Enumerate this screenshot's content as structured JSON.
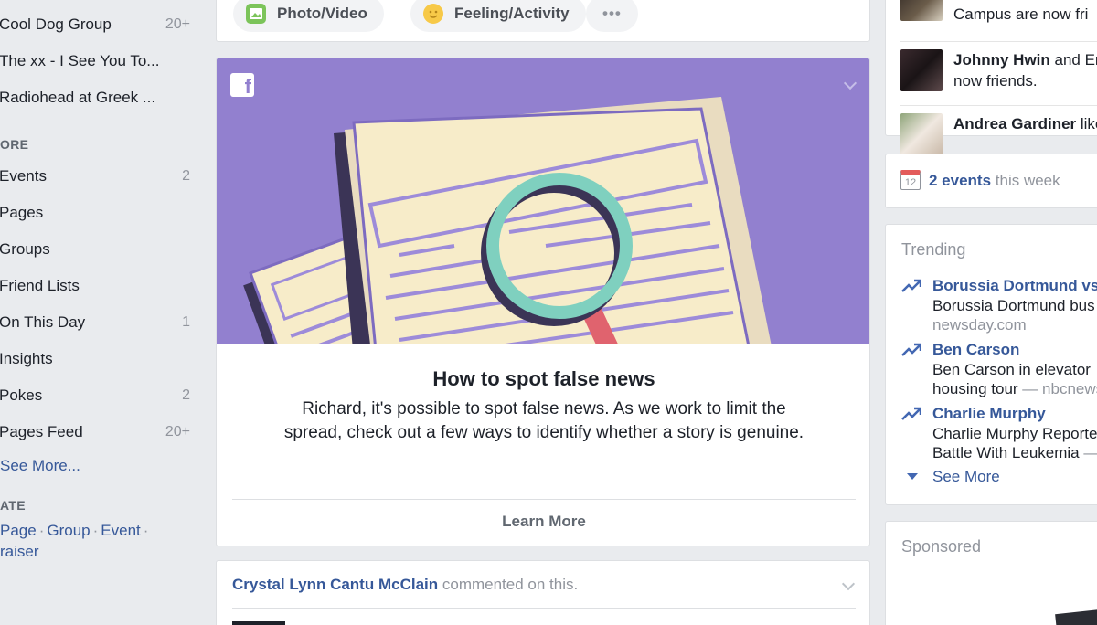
{
  "left_nav": {
    "shortcuts": [
      {
        "label": "Cool Dog Group",
        "count": "20+"
      },
      {
        "label": "The xx - I See You To...",
        "count": ""
      },
      {
        "label": "Radiohead at Greek ...",
        "count": ""
      }
    ],
    "explore_heading": "ORE",
    "explore": [
      {
        "label": "Events",
        "count": "2"
      },
      {
        "label": "Pages",
        "count": ""
      },
      {
        "label": "Groups",
        "count": ""
      },
      {
        "label": "Friend Lists",
        "count": ""
      },
      {
        "label": "On This Day",
        "count": "1"
      },
      {
        "label": "Insights",
        "count": ""
      },
      {
        "label": "Pokes",
        "count": "2"
      },
      {
        "label": "Pages Feed",
        "count": "20+"
      }
    ],
    "see_more": "See More...",
    "create_heading": "ATE",
    "create_links": [
      "Page",
      "Group",
      "Event",
      "raiser"
    ],
    "separator": "·"
  },
  "composer": {
    "photo_video": "Photo/Video",
    "feeling_activity": "Feeling/Activity",
    "more": "•••"
  },
  "news_card": {
    "title": "How to spot false news",
    "body": "Richard, it's possible to spot false news. As we work to limit the spread, check out a few ways to identify whether a story is genuine.",
    "learn_more": "Learn More",
    "logo": "f"
  },
  "post": {
    "author": "Crystal Lynn Cantu McClain",
    "action": " commented on this."
  },
  "ticker": {
    "row1_text": "Campus are now fri",
    "row2_name": "Johnny Hwin",
    "row2_mid": " and Er",
    "row2_line2": "now friends.",
    "row3_name": "Andrea Gardiner",
    "row3_tail": " like"
  },
  "events": {
    "cal_day": "12",
    "count_label": "2 events",
    "suffix": " this week"
  },
  "trending": {
    "heading": "Trending",
    "items": [
      {
        "topic": "Borussia Dortmund vs",
        "desc": "Borussia Dortmund bus",
        "line2": "",
        "source": "newsday.com"
      },
      {
        "topic": "Ben Carson",
        "desc": "Ben Carson in elevator",
        "line2": "housing tour",
        "source": "nbcnews"
      },
      {
        "topic": "Charlie Murphy",
        "desc": "Charlie Murphy Reporte",
        "line2": "Battle With Leukemia",
        "source": ""
      }
    ],
    "source_sep": " — ",
    "see_more": "See More"
  },
  "sponsored": {
    "heading": "Sponsored"
  },
  "colors": {
    "link": "#365899",
    "hero_bg": "#9280cf",
    "page_bg": "#e9ebee"
  }
}
